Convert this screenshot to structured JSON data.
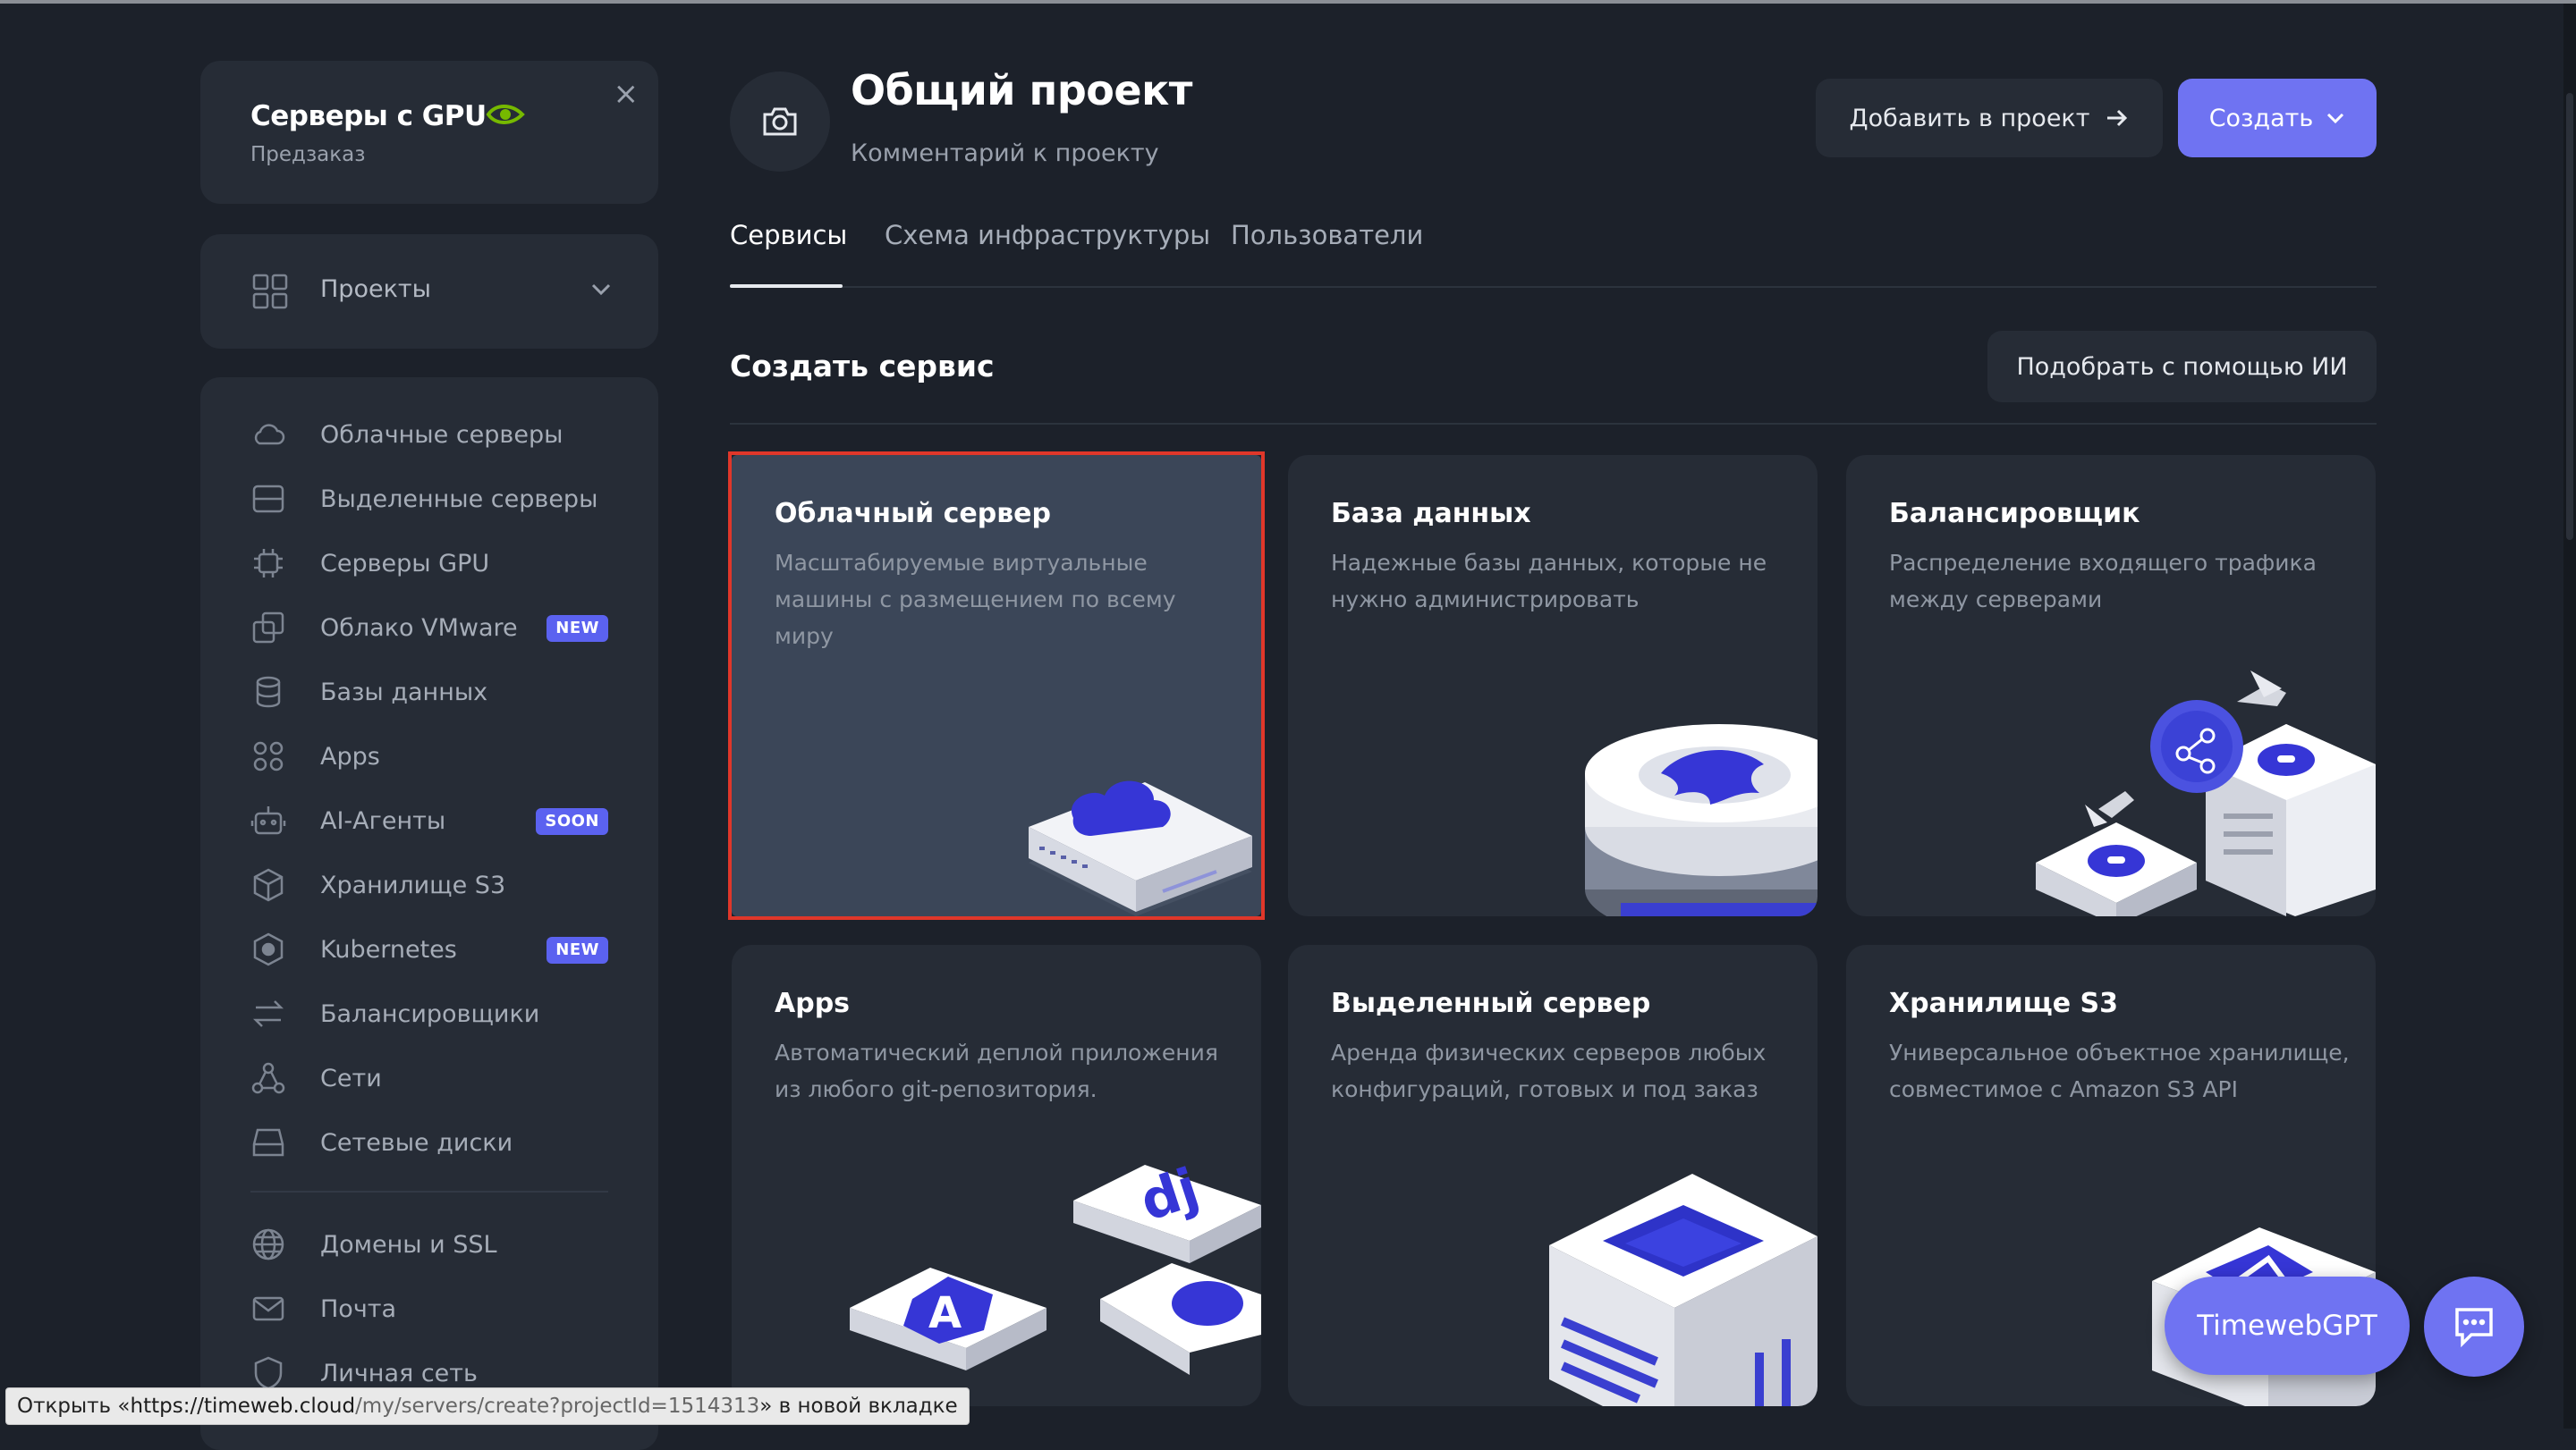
{
  "sidebar": {
    "gpu_banner": {
      "title": "Серверы с GPU",
      "subtitle": "Предзаказ"
    },
    "projects_label": "Проекты",
    "items": [
      {
        "label": "Облачные серверы",
        "icon": "cloud-icon"
      },
      {
        "label": "Выделенные серверы",
        "icon": "server-icon"
      },
      {
        "label": "Серверы GPU",
        "icon": "chip-icon"
      },
      {
        "label": "Облако VMware",
        "icon": "vmware-icon",
        "badge": "NEW"
      },
      {
        "label": "Базы данных",
        "icon": "database-icon"
      },
      {
        "label": "Apps",
        "icon": "apps-icon"
      },
      {
        "label": "AI-Агенты",
        "icon": "robot-icon",
        "badge": "SOON"
      },
      {
        "label": "Хранилище S3",
        "icon": "cube-icon"
      },
      {
        "label": "Kubernetes",
        "icon": "kubernetes-icon",
        "badge": "NEW"
      },
      {
        "label": "Балансировщики",
        "icon": "arrows-icon"
      },
      {
        "label": "Сети",
        "icon": "network-icon"
      },
      {
        "label": "Сетевые диски",
        "icon": "disk-icon"
      }
    ],
    "items_bottom": [
      {
        "label": "Домены и SSL",
        "icon": "globe-icon"
      },
      {
        "label": "Почта",
        "icon": "mail-icon"
      },
      {
        "label": "Личная сеть",
        "icon": "shield-icon"
      }
    ]
  },
  "header": {
    "title": "Общий проект",
    "comment": "Комментарий к проекту",
    "add_to_project": "Добавить в проект",
    "create": "Создать"
  },
  "tabs": [
    "Сервисы",
    "Схема инфраструктуры",
    "Пользователи"
  ],
  "section": {
    "title": "Создать сервис",
    "ai_button": "Подобрать с помощью ИИ"
  },
  "services": [
    {
      "title": "Облачный сервер",
      "desc": "Масштабируемые виртуальные машины с размещением по всему миру"
    },
    {
      "title": "База данных",
      "desc": "Надежные базы данных, которые не нужно администрировать"
    },
    {
      "title": "Балансировщик",
      "desc": "Распределение входящего трафика между серверами"
    },
    {
      "title": "Apps",
      "desc": "Автоматический деплой приложения из любого git-репозитория."
    },
    {
      "title": "Выделенный сервер",
      "desc": "Аренда физических серверов любых конфигураций, готовых и под заказ"
    },
    {
      "title": "Хранилище S3",
      "desc": "Универсальное объектное хранилище, совместимое с Amazon S3 API"
    }
  ],
  "floating": {
    "gpt_label": "TimewebGPT"
  },
  "status_bar": {
    "prefix": "Открыть «",
    "url_host": "https://timeweb.cloud",
    "url_path": "/my/servers/create?projectId=1514313",
    "suffix": "» в новой вкладке"
  },
  "colors": {
    "background": "#1c212a",
    "card": "#262c36",
    "accent": "#6f73f2",
    "badge": "#5b62f0",
    "highlight": "#e0372a"
  }
}
